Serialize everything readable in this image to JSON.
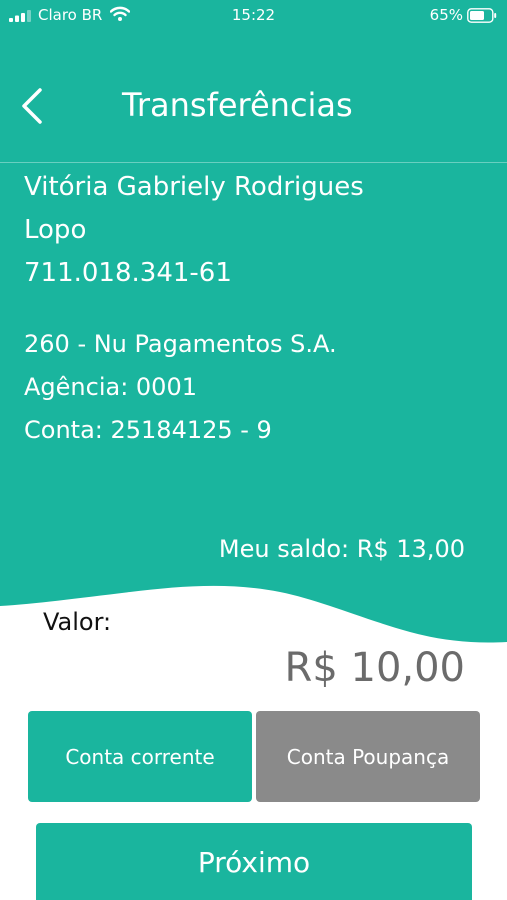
{
  "colors": {
    "primary": "#1ab59e",
    "secondary_gray": "#8a8a8a",
    "amount_text": "#6b6b6b"
  },
  "status_bar": {
    "carrier": "Claro BR",
    "time": "15:22",
    "battery": "65%",
    "icons": [
      "signal-icon",
      "wifi-icon",
      "battery-icon"
    ]
  },
  "header": {
    "title": "Transferências",
    "back_icon": "chevron-left-icon"
  },
  "recipient": {
    "name_line1": "Vitória Gabriely Rodrigues",
    "name_line2": "Lopo",
    "cpf": "711.018.341-61"
  },
  "bank": {
    "name": "260 - Nu Pagamentos S.A.",
    "agency": "Agência: 0001",
    "account": "Conta: 25184125 - 9"
  },
  "balance": "Meu saldo: R$ 13,00",
  "value_label": "Valor:",
  "amount": "R$ 10,00",
  "account_types": [
    {
      "label": "Conta corrente",
      "selected": true
    },
    {
      "label": "Conta Poupança",
      "selected": false
    }
  ],
  "next_button": "Próximo"
}
